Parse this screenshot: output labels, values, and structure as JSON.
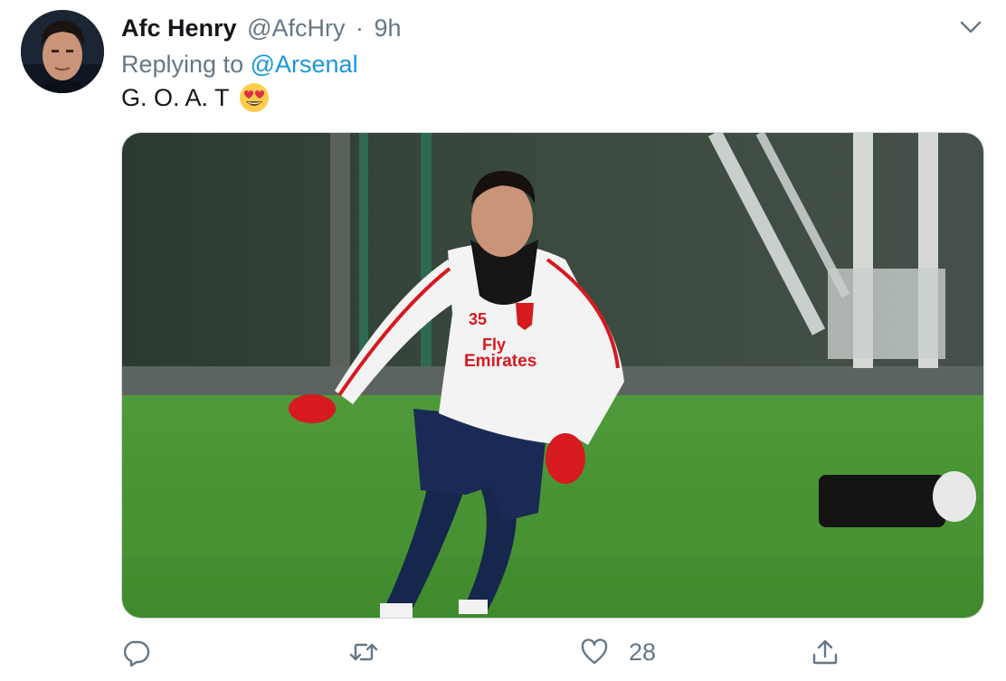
{
  "tweet": {
    "display_name": "Afc Henry",
    "handle": "@AfcHry",
    "separator": "·",
    "time": "9h",
    "replying_to_label": "Replying to",
    "replying_to_mention": "@Arsenal",
    "text": "G. O. A. T",
    "emoji": "smiling-face-with-heart-eyes"
  },
  "media": {
    "shirt_number": "35",
    "sponsor_line1": "Fly",
    "sponsor_line2": "Emirates"
  },
  "actions": {
    "reply_icon": "reply-icon",
    "retweet_icon": "retweet-icon",
    "like_icon": "heart-icon",
    "like_count": "28",
    "share_icon": "share-icon"
  },
  "colors": {
    "link": "#1b95e0",
    "secondary_text": "#657786",
    "primary_text": "#14171a",
    "border": "#ccd6dd"
  }
}
